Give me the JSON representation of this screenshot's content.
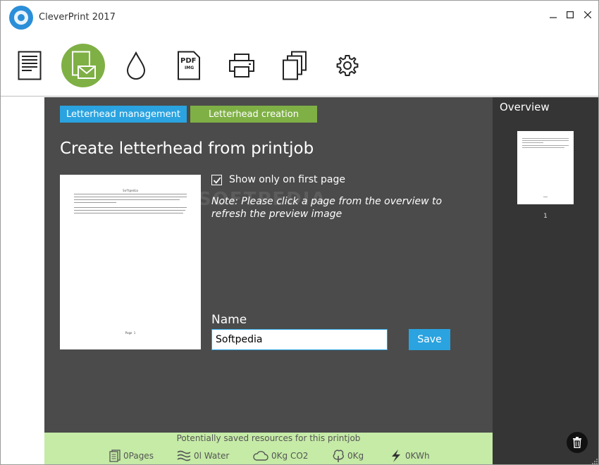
{
  "app": {
    "title": "CleverPrint 2017"
  },
  "toolbar": {
    "items": [
      {
        "name": "document",
        "icon": "document-icon"
      },
      {
        "name": "letterhead",
        "icon": "letterhead-icon",
        "active": true
      },
      {
        "name": "ink",
        "icon": "ink-drop-icon"
      },
      {
        "name": "pdf-img",
        "icon": "pdf-img-icon",
        "pdf_label": "PDF",
        "img_label": "IMG"
      },
      {
        "name": "print",
        "icon": "printer-icon"
      },
      {
        "name": "copies",
        "icon": "copies-icon"
      },
      {
        "name": "settings",
        "icon": "gear-icon"
      }
    ]
  },
  "tabs": {
    "management": "Letterhead management",
    "creation": "Letterhead creation"
  },
  "main": {
    "title": "Create letterhead from printjob",
    "checkbox_label": "Show only on first page",
    "checkbox_checked": true,
    "note": "Note: Please click a page from the overview to refresh the preview image",
    "name_label": "Name",
    "name_value": "Softpedia",
    "save_label": "Save",
    "watermark": "SOFTPEDIA"
  },
  "preview": {
    "doc_title": "Softpedia",
    "doc_footer": "Page 1"
  },
  "overview": {
    "title": "Overview",
    "pages": [
      {
        "number": "1"
      }
    ]
  },
  "footer": {
    "title": "Potentially saved resources for this printjob",
    "stats": [
      {
        "icon": "pages-icon",
        "value": "0",
        "unit": "Pages"
      },
      {
        "icon": "water-icon",
        "value": "0",
        "unit": "l Water"
      },
      {
        "icon": "cloud-icon",
        "value": "0",
        "unit": "Kg CO2"
      },
      {
        "icon": "tree-icon",
        "value": "0",
        "unit": "Kg"
      },
      {
        "icon": "energy-icon",
        "value": "0",
        "unit": "KWh"
      }
    ]
  },
  "colors": {
    "blue": "#2aa3e0",
    "green": "#7fb045",
    "panel": "#4b4b4b",
    "overview": "#353535",
    "footer": "#c5eba6"
  }
}
